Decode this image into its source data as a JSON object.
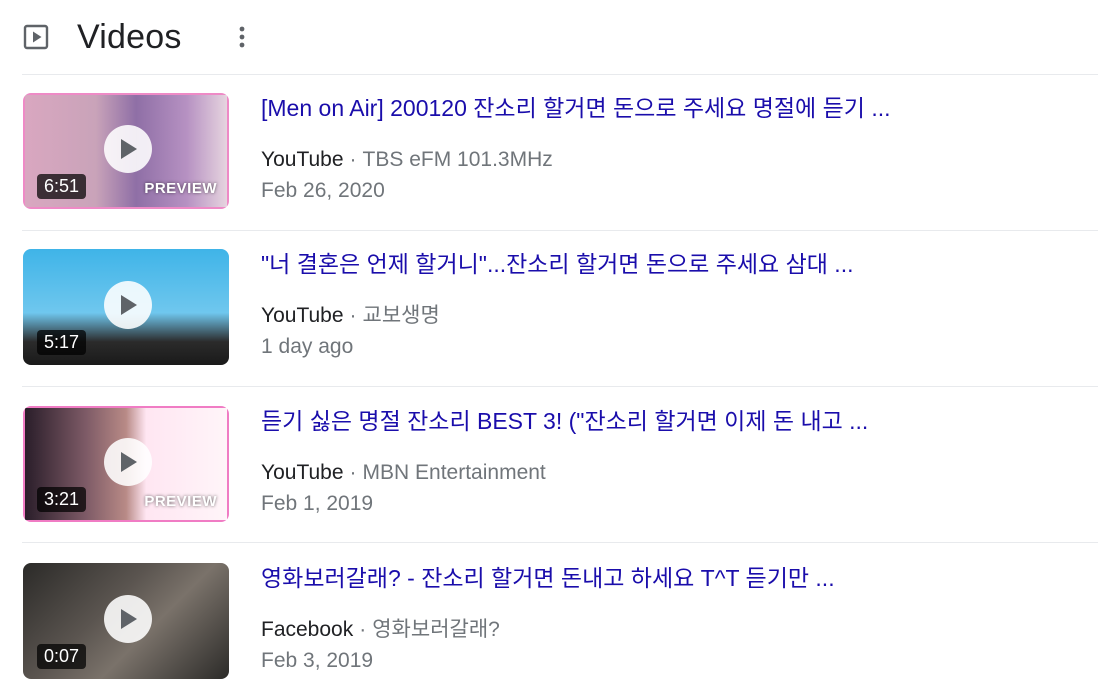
{
  "header": {
    "title": "Videos",
    "icon": "video-play-icon",
    "menu_icon": "more-vert-icon"
  },
  "colors": {
    "link": "#1a0dab",
    "text": "#202124",
    "muted": "#70757a",
    "divider": "#e8eaed"
  },
  "results": [
    {
      "title": "[Men on Air] 200120 잔소리 할거면 돈으로 주세요 명절에 듣기 ...",
      "source": "YouTube",
      "separator": "·",
      "channel": "TBS eFM 101.3MHz",
      "date": "Feb 26, 2020",
      "duration": "6:51",
      "preview": "PREVIEW"
    },
    {
      "title": "\"너 결혼은 언제 할거니\"...잔소리 할거면 돈으로 주세요 삼대 ...",
      "source": "YouTube",
      "separator": "·",
      "channel": "교보생명",
      "date": "1 day ago",
      "duration": "5:17",
      "preview": ""
    },
    {
      "title": "듣기 싫은 명절 잔소리 BEST 3! (\"잔소리 할거면 이제 돈 내고 ...",
      "source": "YouTube",
      "separator": "·",
      "channel": "MBN Entertainment",
      "date": "Feb 1, 2019",
      "duration": "3:21",
      "preview": "PREVIEW"
    },
    {
      "title": "영화보러갈래? - 잔소리 할거면 돈내고 하세요 T^T  듣기만 ...",
      "source": "Facebook",
      "separator": "·",
      "channel": "영화보러갈래?",
      "date": "Feb 3, 2019",
      "duration": "0:07",
      "preview": ""
    }
  ]
}
